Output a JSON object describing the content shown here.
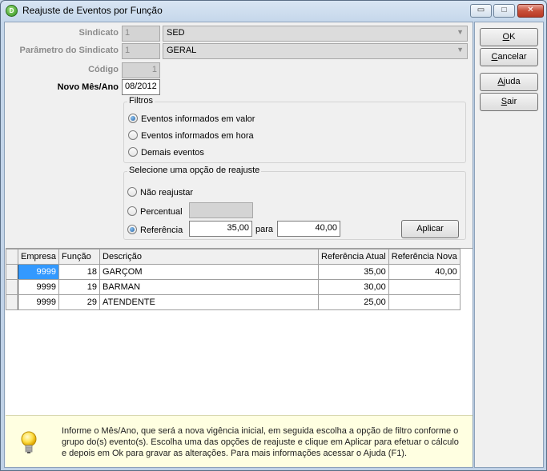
{
  "window": {
    "title": "Reajuste de Eventos por Função",
    "min_glyph": "▭",
    "max_glyph": "□",
    "close_glyph": "✕"
  },
  "form": {
    "sindicato_label": "Sindicato",
    "sindicato_code": "1",
    "sindicato_value": "SED",
    "parametro_label": "Parâmetro do Sindicato",
    "parametro_code": "1",
    "parametro_value": "GERAL",
    "codigo_label": "Código",
    "codigo_value": "1",
    "mes_ano_label": "Novo Mês/Ano",
    "mes_ano_value": "08/2012"
  },
  "filtros": {
    "title": "Filtros",
    "options": [
      {
        "label": "Eventos informados em valor",
        "checked": true
      },
      {
        "label": "Eventos informados em hora",
        "checked": false
      },
      {
        "label": "Demais eventos",
        "checked": false
      }
    ]
  },
  "reajuste": {
    "title": "Selecione uma opção de reajuste",
    "nao_reajustar": "Não reajustar",
    "percentual": "Percentual",
    "referencia": "Referência",
    "referencia_de": "35,00",
    "para_label": "para",
    "referencia_para": "40,00",
    "aplicar_label": "Aplicar"
  },
  "side_buttons": {
    "ok": {
      "u": "O",
      "rest": "K"
    },
    "cancelar": {
      "u": "C",
      "rest": "ancelar"
    },
    "ajuda": {
      "u": "A",
      "rest": "juda"
    },
    "sair": {
      "u": "S",
      "rest": "air"
    }
  },
  "table": {
    "columns": [
      "Empresa",
      "Função",
      "Descrição",
      "Referência Atual",
      "Referência Nova"
    ],
    "rows": [
      {
        "empresa": "9999",
        "funcao": "18",
        "descricao": "GARÇOM",
        "ref_atual": "35,00",
        "ref_nova": "40,00"
      },
      {
        "empresa": "9999",
        "funcao": "19",
        "descricao": "BARMAN",
        "ref_atual": "30,00",
        "ref_nova": ""
      },
      {
        "empresa": "9999",
        "funcao": "29",
        "descricao": "ATENDENTE",
        "ref_atual": "25,00",
        "ref_nova": ""
      }
    ]
  },
  "hint": {
    "icon": "lightbulb-icon",
    "text": "Informe o Mês/Ano, que será a nova vigência inicial, em seguida escolha a opção de filtro conforme o grupo do(s) evento(s). Escolha uma das opções de reajuste e clique em Aplicar para efetuar o cálculo e depois em Ok para gravar as alterações. Para mais informações acessar o Ajuda (F1)."
  }
}
